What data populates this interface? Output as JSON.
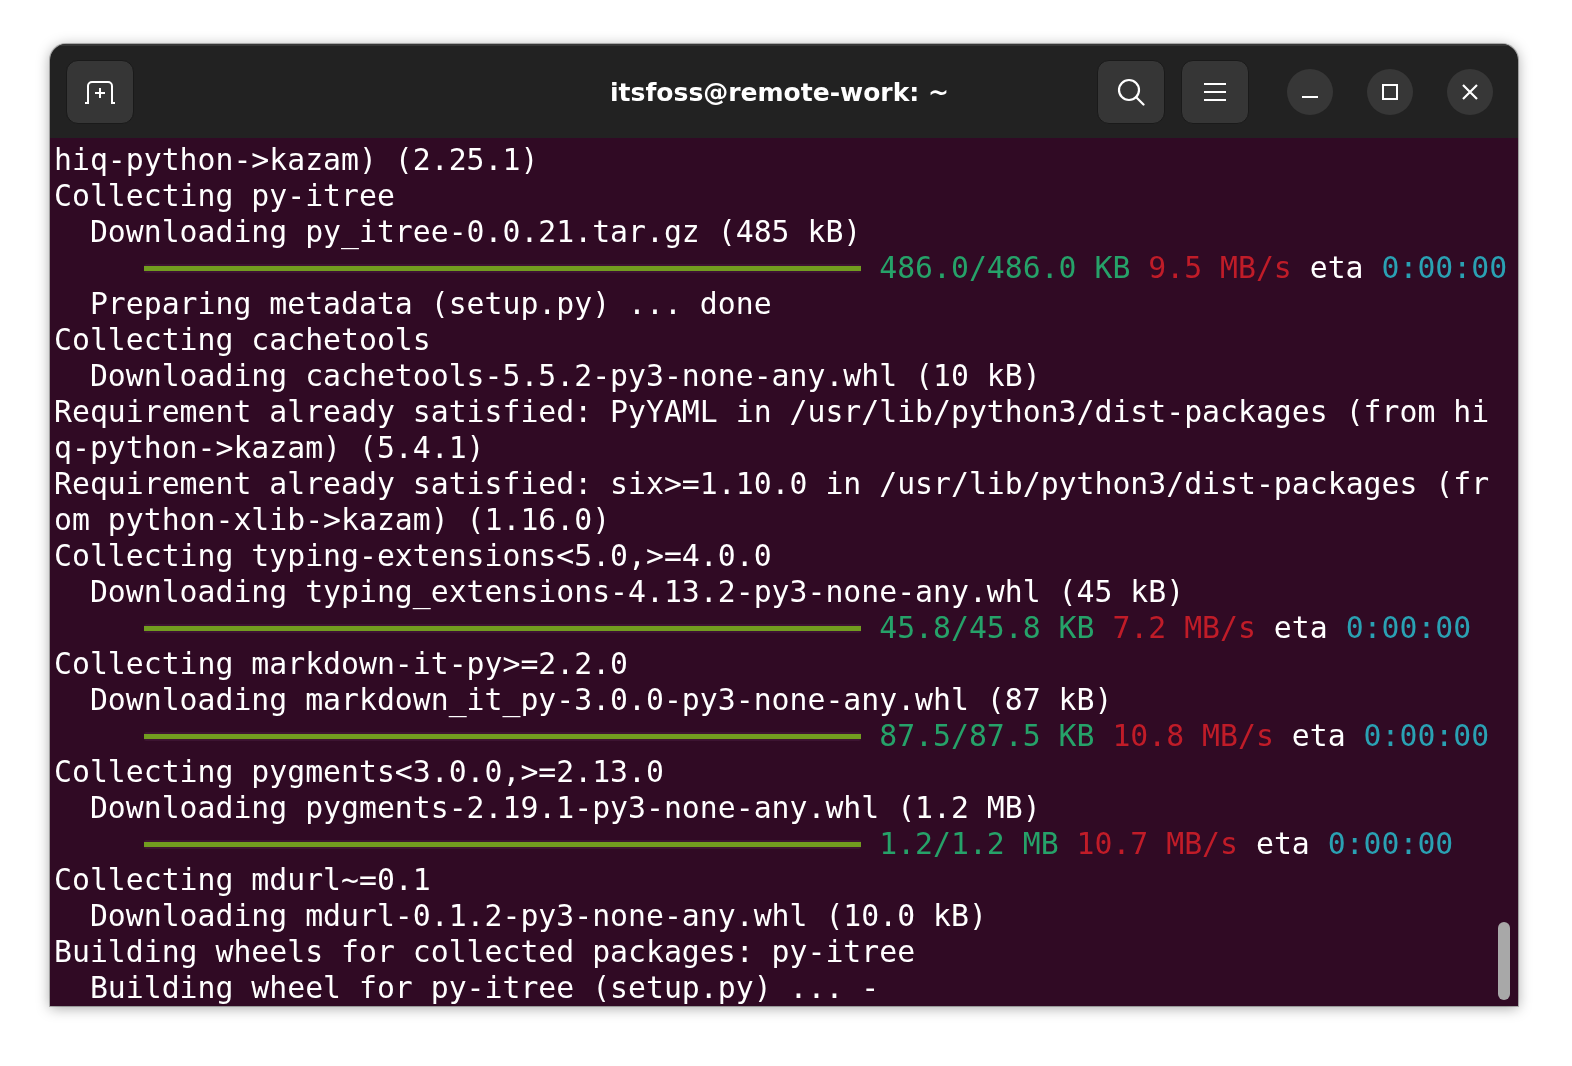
{
  "window": {
    "title": "itsfoss@remote-work: ~"
  },
  "terminal": {
    "lines": [
      {
        "kind": "text",
        "text": "hiq-python->kazam) (2.25.1)"
      },
      {
        "kind": "text",
        "text": "Collecting py-itree"
      },
      {
        "kind": "indented",
        "text": "Downloading py_itree-0.0.21.tar.gz (485 kB)"
      },
      {
        "kind": "progress",
        "level": 1,
        "amount": "486.0/486.0 KB",
        "speed": "9.5 MB/s",
        "eta_label": "eta",
        "eta": "0:00:00"
      },
      {
        "kind": "indented",
        "text": "Preparing metadata (setup.py) ... done"
      },
      {
        "kind": "text",
        "text": "Collecting cachetools"
      },
      {
        "kind": "indented",
        "text": "Downloading cachetools-5.5.2-py3-none-any.whl (10 kB)"
      },
      {
        "kind": "text",
        "text": "Requirement already satisfied: PyYAML in /usr/lib/python3/dist-packages (from hi"
      },
      {
        "kind": "text",
        "text": "q-python->kazam) (5.4.1)"
      },
      {
        "kind": "text",
        "text": "Requirement already satisfied: six>=1.10.0 in /usr/lib/python3/dist-packages (fr"
      },
      {
        "kind": "text",
        "text": "om python-xlib->kazam) (1.16.0)"
      },
      {
        "kind": "text",
        "text": "Collecting typing-extensions<5.0,>=4.0.0"
      },
      {
        "kind": "indented",
        "text": "Downloading typing_extensions-4.13.2-py3-none-any.whl (45 kB)"
      },
      {
        "kind": "progress",
        "level": 1,
        "amount": "45.8/45.8 KB",
        "speed": "7.2 MB/s",
        "eta_label": "eta",
        "eta": "0:00:00"
      },
      {
        "kind": "text",
        "text": "Collecting markdown-it-py>=2.2.0"
      },
      {
        "kind": "indented",
        "text": "Downloading markdown_it_py-3.0.0-py3-none-any.whl (87 kB)"
      },
      {
        "kind": "progress",
        "level": 1,
        "amount": "87.5/87.5 KB",
        "speed": "10.8 MB/s",
        "eta_label": "eta",
        "eta": "0:00:00"
      },
      {
        "kind": "text",
        "text": "Collecting pygments<3.0.0,>=2.13.0"
      },
      {
        "kind": "indented",
        "text": "Downloading pygments-2.19.1-py3-none-any.whl (1.2 MB)"
      },
      {
        "kind": "progress",
        "level": 1,
        "amount": "1.2/1.2 MB",
        "speed": "10.7 MB/s",
        "eta_label": "eta",
        "eta": "0:00:00"
      },
      {
        "kind": "text",
        "text": "Collecting mdurl~=0.1"
      },
      {
        "kind": "indented",
        "text": "Downloading mdurl-0.1.2-py3-none-any.whl (10.0 kB)"
      },
      {
        "kind": "text",
        "text": "Building wheels for collected packages: py-itree"
      },
      {
        "kind": "indented",
        "text": "Building wheel for py-itree (setup.py) ... -"
      }
    ]
  }
}
